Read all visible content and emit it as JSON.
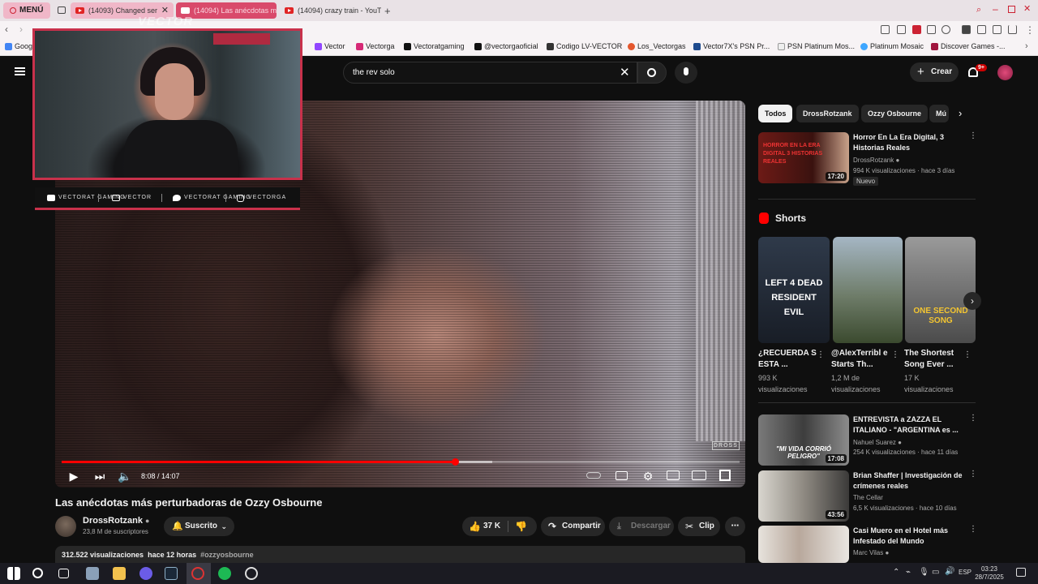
{
  "browser": {
    "menu_label": "MENÚ",
    "tabs": [
      {
        "label": "(14093) Changed ser"
      },
      {
        "label": "(14094) Las anécdotas m"
      },
      {
        "label": "(14094) crazy train - YouT"
      }
    ],
    "bookmarks": [
      "Vector",
      "Vectorga",
      "Vectoratgaming",
      "@vectorgaoficial",
      "Codigo LV-VECTOR",
      "Los_Vectorgas",
      "Vector7X's PSN Pr...",
      "PSN Platinum Mos...",
      "Platinum Mosaic",
      "Discover Games -..."
    ],
    "bookmark_first": "Goog"
  },
  "youtube": {
    "search_value": "the rev solo",
    "create_label": "Crear",
    "notif_count": "9+",
    "player": {
      "time": "8:08 / 14:07",
      "progress": 0.58,
      "watermark": "DROSS"
    },
    "video": {
      "title": "Las anécdotas más perturbadoras de Ozzy Osbourne",
      "channel": "DrossRotzank",
      "subscribers": "23,8 M de suscriptores",
      "subscribed_label": "Suscrito",
      "likes": "37 K",
      "share_label": "Compartir",
      "download_label": "Descargar",
      "clip_label": "Clip",
      "views": "312.522 visualizaciones",
      "age": "hace 12 horas",
      "hashtag": "#ozzyosbourne"
    },
    "chips": [
      "Todos",
      "DrossRotzank",
      "Ozzy Osbourne",
      "Mú"
    ],
    "shorts_heading": "Shorts",
    "related_top": {
      "title": "Horror En La Era Digital, 3 Historias Reales",
      "channel": "DrossRotzank",
      "meta": "994 K visualizaciones · hace 3 días",
      "badge": "Nuevo",
      "duration": "17:20",
      "thumb_text": "HORROR EN LA ERA DIGITAL 3 HISTORIAS REALES"
    },
    "shorts": [
      {
        "title": "¿RECUERDA S ESTA ...",
        "views": "993 K visualizaciones",
        "thumb_text": "LEFT 4 DEAD RESIDENT EVIL"
      },
      {
        "title": "@AlexTerribl e Starts Th...",
        "views": "1,2 M de visualizaciones",
        "thumb_text": ""
      },
      {
        "title": "The Shortest Song Ever ...",
        "views": "17 K visualizaciones",
        "thumb_text": "ONE SECOND SONG"
      }
    ],
    "related": [
      {
        "title": "ENTREVISTA a ZAZZA EL ITALIANO - \"ARGENTINA es ...",
        "channel": "Nahuel Suarez",
        "meta": "254 K visualizaciones · hace 11 días",
        "duration": "17:08",
        "thumb_text": "\"MI VIDA CORRIÓ PELIGRO\""
      },
      {
        "title": "Brian Shaffer | Investigación de crímenes reales",
        "channel": "The Cellar",
        "meta": "6,5 K visualizaciones · hace 10 días",
        "duration": "43:56",
        "thumb_text": ""
      },
      {
        "title": "Casi Muero en el Hotel más Infestado del Mundo",
        "channel": "Marc Vilas",
        "meta": "",
        "duration": "",
        "thumb_text": ""
      }
    ]
  },
  "overlay": {
    "logo_text": "VECTOR",
    "socials": [
      "VECTORAT GAMING",
      "VECTOR",
      "VECTORAT GAMING",
      "VECTORGA"
    ]
  },
  "taskbar": {
    "lang": "ESP",
    "time": "03:23",
    "date": "28/7/2025"
  },
  "colors": {
    "accent_red": "#ff0000",
    "overlay_red": "#c8314b",
    "bg": "#0f0f0f"
  }
}
